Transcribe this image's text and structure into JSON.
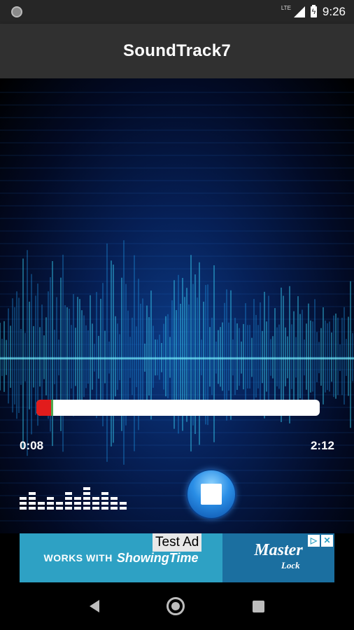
{
  "status_bar": {
    "network": "LTE",
    "time": "9:26"
  },
  "app_bar": {
    "title": "SoundTrack7"
  },
  "player": {
    "elapsed": "0:08",
    "total": "2:12",
    "progress_fraction": 0.06
  },
  "ad": {
    "label": "Test Ad",
    "left_text": "WORKS WITH",
    "left_brand": "ShowingTime",
    "right_brand": "Master",
    "right_brand_sub": "Lock",
    "choices": [
      "▷",
      "✕"
    ]
  },
  "nav": {
    "back_icon": "back-triangle-icon",
    "home_icon": "home-circle-icon",
    "recent_icon": "recent-apps-square-icon"
  },
  "colors": {
    "progress_fill": "#e21c1c",
    "progress_track": "#ffffff",
    "ad_left_bg": "#2ea1c4",
    "ad_right_bg": "#1b6fa0",
    "app_bar_bg": "#303030"
  }
}
